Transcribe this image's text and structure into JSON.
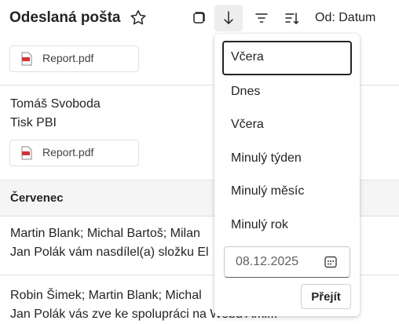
{
  "header": {
    "title": "Odeslaná pošta",
    "sort_label": "Od: Datum"
  },
  "mails": [
    {
      "attachment": "Report.pdf"
    },
    {
      "sender": "Tomáš Svoboda",
      "subject": "Tisk PBI",
      "attachment": "Report.pdf"
    },
    {
      "sender": "Martin Blank; Michal Bartoš; Milan",
      "preview": "Jan Polák vám nasdílel(a) složku El"
    },
    {
      "sender": "Robin Šimek; Martin Blank; Michal",
      "preview": "Jan Polák vás zve ke spolupráci na Webu Ami..."
    }
  ],
  "group_header": "Červenec",
  "dropdown": {
    "options": [
      "Včera",
      "Dnes",
      "Včera",
      "Minulý týden",
      "Minulý měsíc",
      "Minulý rok"
    ],
    "date_value": "08.12.2025",
    "go_label": "Přejít"
  }
}
